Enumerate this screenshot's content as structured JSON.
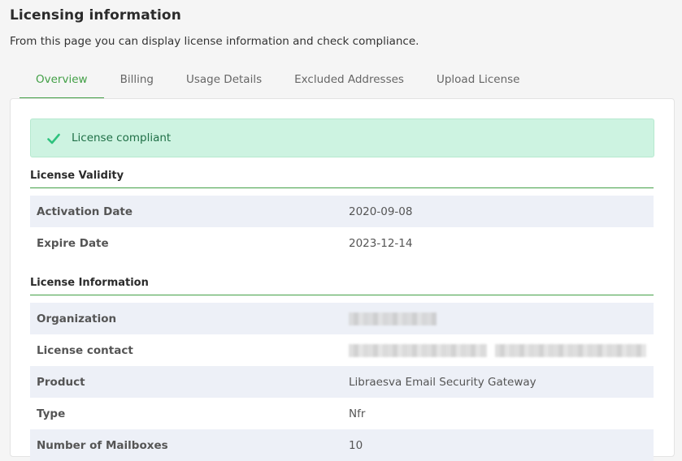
{
  "page": {
    "title": "Licensing information",
    "subtitle": "From this page you can display license information and check compliance."
  },
  "tabs": [
    {
      "label": "Overview",
      "active": true
    },
    {
      "label": "Billing",
      "active": false
    },
    {
      "label": "Usage Details",
      "active": false
    },
    {
      "label": "Excluded Addresses",
      "active": false
    },
    {
      "label": "Upload License",
      "active": false
    }
  ],
  "alert": {
    "icon": "check-icon",
    "text": "License compliant",
    "color": "#cdf3e1"
  },
  "license_validity": {
    "title": "License Validity",
    "rows": [
      {
        "key": "Activation Date",
        "value": "2020-09-08"
      },
      {
        "key": "Expire Date",
        "value": "2023-12-14"
      }
    ]
  },
  "license_information": {
    "title": "License Information",
    "rows": [
      {
        "key": "Organization",
        "value": ""
      },
      {
        "key": "License contact",
        "value": ""
      },
      {
        "key": "Product",
        "value": "Libraesva Email Security Gateway"
      },
      {
        "key": "Type",
        "value": "Nfr"
      },
      {
        "key": "Number of Mailboxes",
        "value": "10"
      }
    ]
  },
  "colors": {
    "accent": "#43a047",
    "row_shade": "#edf0f7"
  }
}
